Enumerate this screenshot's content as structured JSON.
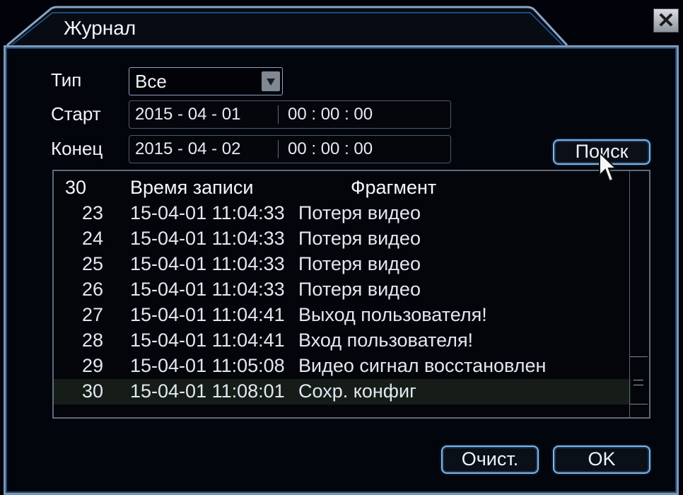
{
  "dialog": {
    "title": "Журнал",
    "close_label": "✕"
  },
  "filters": {
    "type_label": "Тип",
    "type_value": "Все",
    "start_label": "Старт",
    "start_date": "2015  - 04 - 01",
    "start_time": "00 : 00 : 00",
    "end_label": "Конец",
    "end_date": "2015  - 04 - 02",
    "end_time": "00 : 00 : 00",
    "search_label": "Поиск"
  },
  "table": {
    "headers": [
      "30",
      "Время записи",
      "Фрагмент"
    ],
    "rows": [
      {
        "num": "23",
        "time": "15-04-01 11:04:33",
        "event": "Потеря видео"
      },
      {
        "num": "24",
        "time": "15-04-01 11:04:33",
        "event": "Потеря видео"
      },
      {
        "num": "25",
        "time": "15-04-01 11:04:33",
        "event": "Потеря видео"
      },
      {
        "num": "26",
        "time": "15-04-01 11:04:33",
        "event": "Потеря видео"
      },
      {
        "num": "27",
        "time": "15-04-01 11:04:41",
        "event": "Выход пользователя!"
      },
      {
        "num": "28",
        "time": "15-04-01 11:04:41",
        "event": "Вход пользователя!"
      },
      {
        "num": "29",
        "time": "15-04-01 11:05:08",
        "event": "Видео сигнал восстановлен"
      },
      {
        "num": "30",
        "time": "15-04-01 11:08:01",
        "event": "Сохр. конфиг"
      }
    ],
    "selected_row": 7
  },
  "footer": {
    "clear_label": "Очист.",
    "ok_label": "OK"
  },
  "colors": {
    "background": "#03050c",
    "frame": "#7d96b2",
    "button_border": "#7fb8e8",
    "selected_row": "#161d18"
  },
  "icons": {
    "close": "close-icon",
    "dropdown": "chevron-down-icon",
    "cursor": "mouse-pointer-icon"
  }
}
